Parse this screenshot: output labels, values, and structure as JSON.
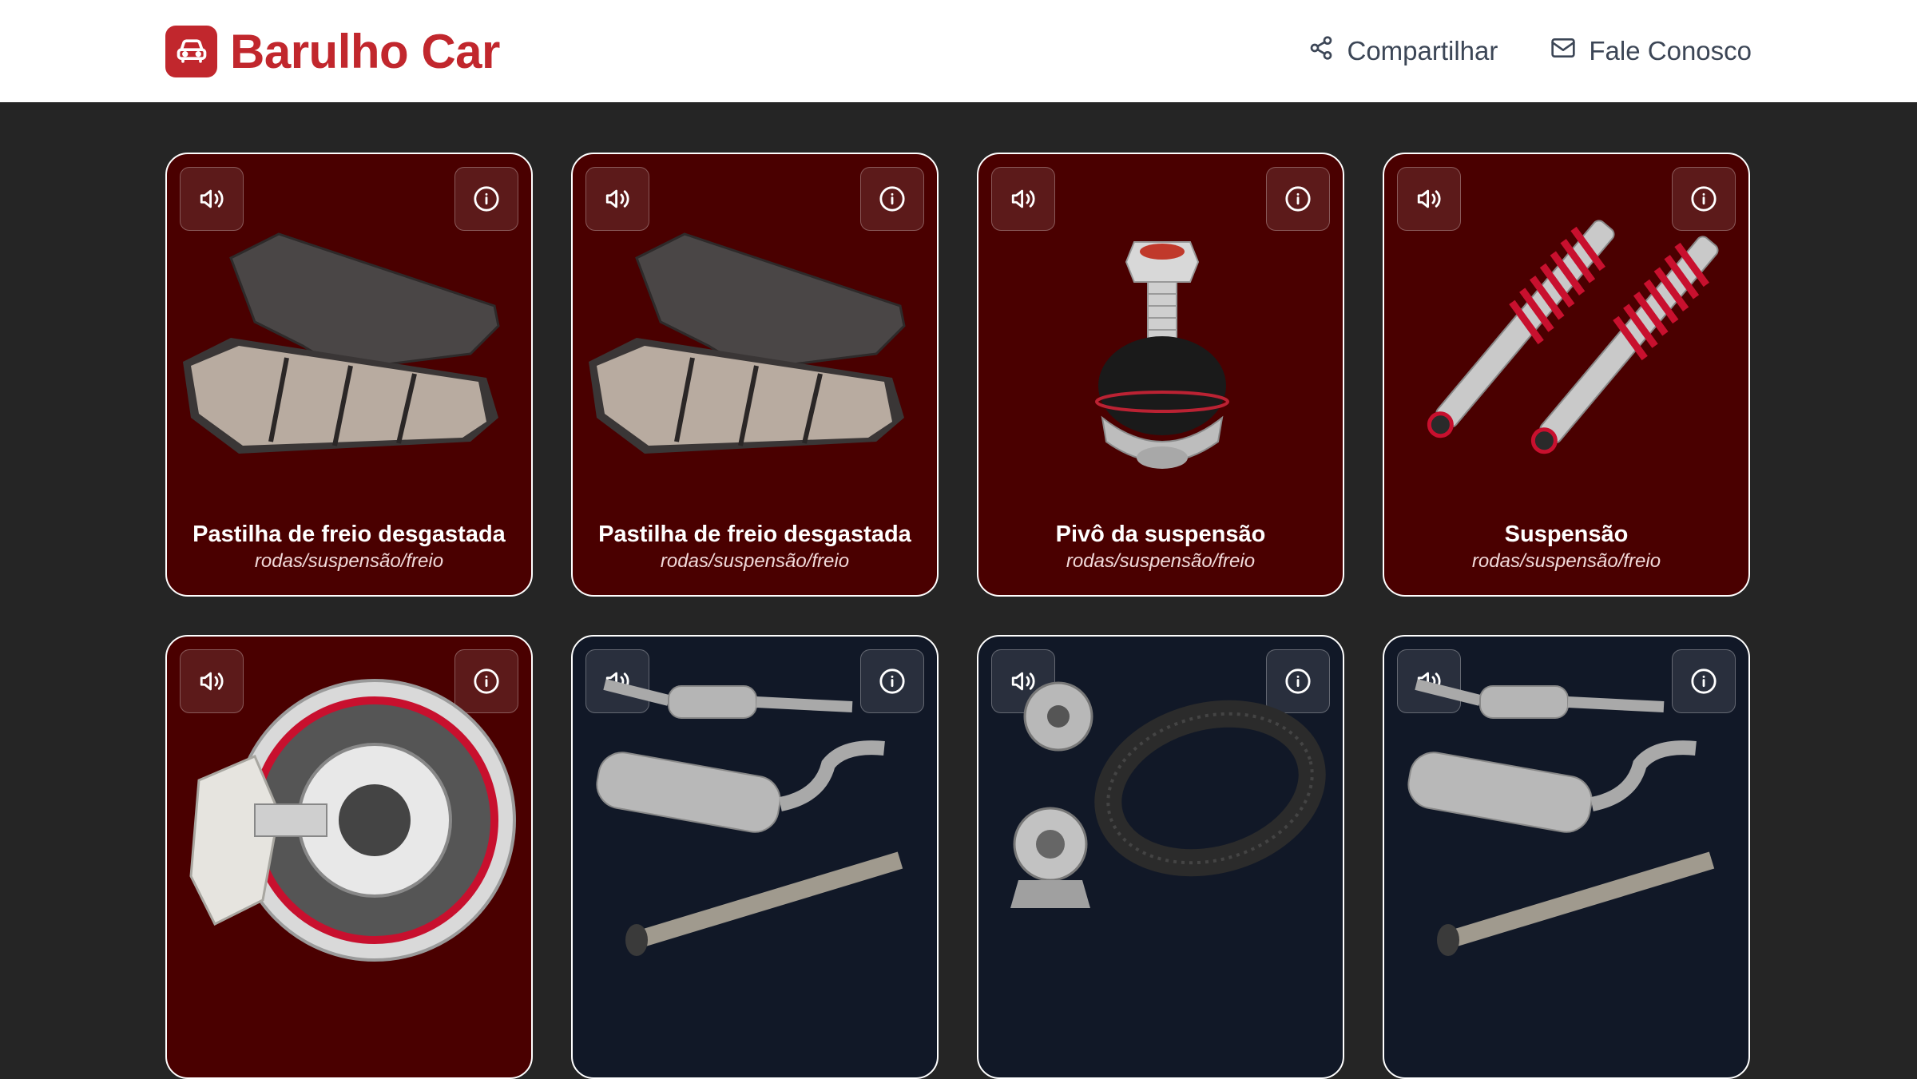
{
  "header": {
    "brand": "Barulho Car",
    "brand_icon": "car-icon",
    "share_label": "Compartilhar",
    "share_icon": "share-icon",
    "contact_label": "Fale Conosco",
    "contact_icon": "mail-icon",
    "brand_color": "#c1272d"
  },
  "cards": [
    {
      "title": "Pastilha de freio desgastada",
      "subtitle": "rodas/suspensão/freio",
      "image": "brake-pads",
      "theme": "red"
    },
    {
      "title": "Pastilha de freio desgastada",
      "subtitle": "rodas/suspensão/freio",
      "image": "brake-pads",
      "theme": "red"
    },
    {
      "title": "Pivô da suspensão",
      "subtitle": "rodas/suspensão/freio",
      "image": "ball-joint",
      "theme": "red"
    },
    {
      "title": "Suspensão",
      "subtitle": "rodas/suspensão/freio",
      "image": "shock-absorbers",
      "theme": "red"
    },
    {
      "title": "",
      "subtitle": "",
      "image": "drum-brake",
      "theme": "red"
    },
    {
      "title": "",
      "subtitle": "",
      "image": "exhaust-system",
      "theme": "navy"
    },
    {
      "title": "",
      "subtitle": "",
      "image": "timing-belt-kit",
      "theme": "navy"
    },
    {
      "title": "",
      "subtitle": "",
      "image": "exhaust-system",
      "theme": "navy"
    }
  ],
  "colors": {
    "page_bg": "#252525",
    "card_red": "#4a0000",
    "card_navy": "#111827"
  }
}
